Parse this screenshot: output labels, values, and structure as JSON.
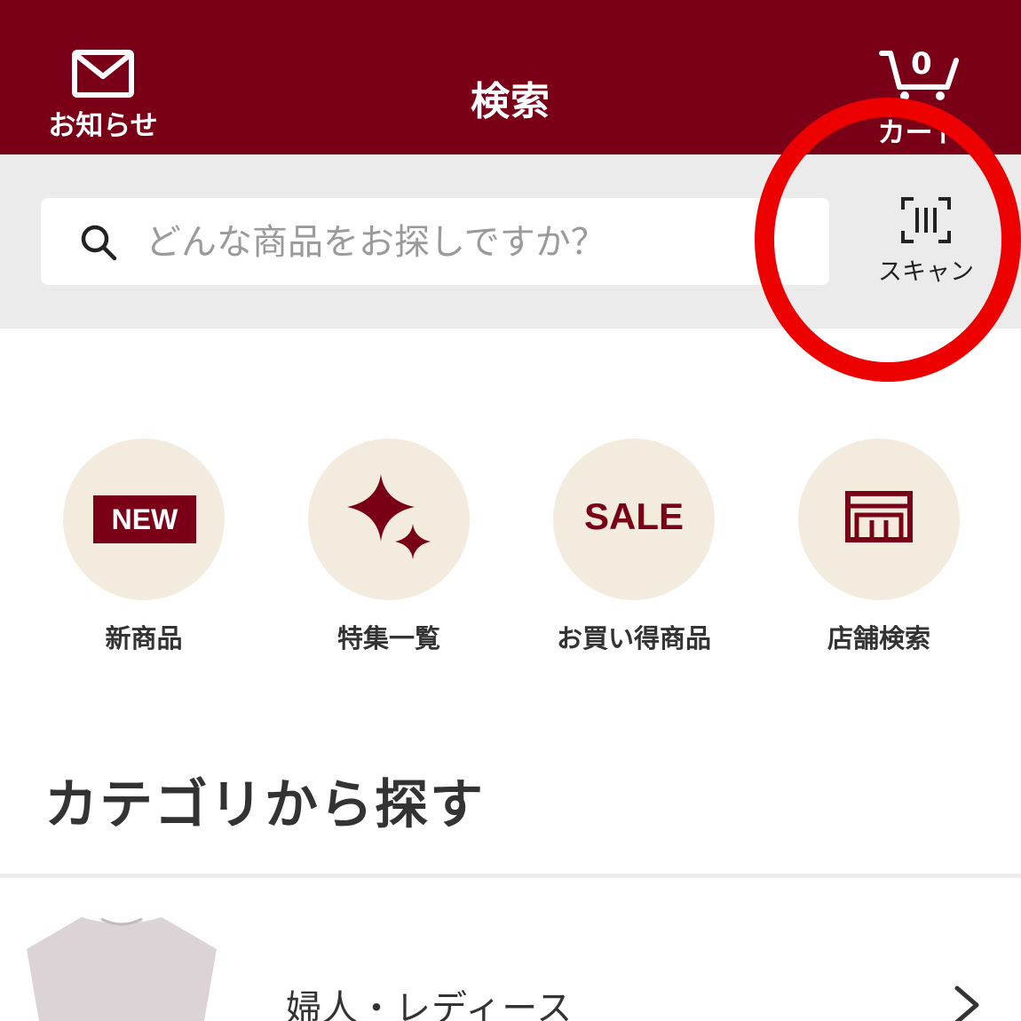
{
  "header": {
    "title": "検索",
    "notifications_label": "お知らせ",
    "cart_label": "カート",
    "cart_count": "0"
  },
  "search": {
    "placeholder": "どんな商品をお探しですか？",
    "value": "",
    "scan_label": "スキャン"
  },
  "quick_links": [
    {
      "label": "新商品",
      "badge": "NEW",
      "icon": "new-badge-icon"
    },
    {
      "label": "特集一覧",
      "icon": "sparkle-icon"
    },
    {
      "label": "お買い得商品",
      "badge": "SALE",
      "icon": "sale-icon"
    },
    {
      "label": "店舗検索",
      "icon": "store-icon"
    }
  ],
  "categories": {
    "title": "カテゴリから探す",
    "items": [
      {
        "label": "婦人・レディース",
        "icon": "tshirt-icon"
      }
    ]
  },
  "colors": {
    "brand": "#7a0018",
    "search_band": "#ebebeb",
    "quick_circle": "#f3ebdd",
    "highlight": "#ec0000"
  }
}
